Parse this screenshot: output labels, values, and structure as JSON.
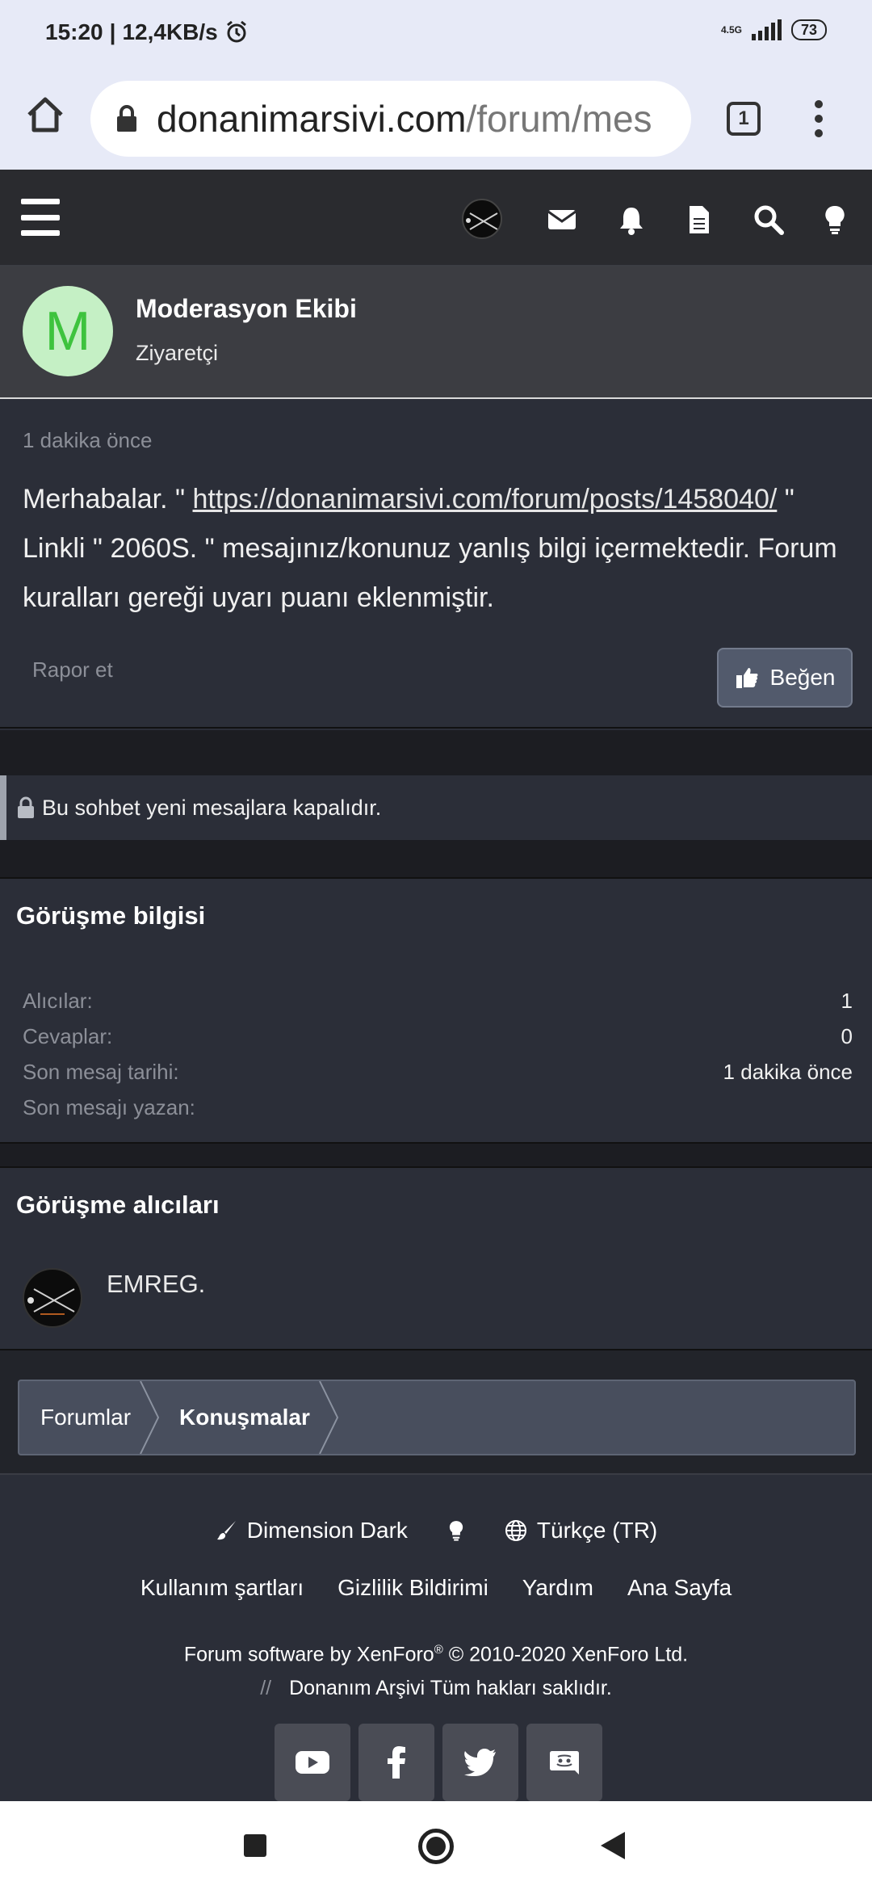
{
  "status_bar": {
    "time": "15:20",
    "speed": "12,4KB/s",
    "network": "4.5G",
    "battery": "73"
  },
  "browser": {
    "url_host": "donanimarsivi.com",
    "url_path": "/forum/mes",
    "tab_count": "1"
  },
  "message": {
    "author_initial": "M",
    "author_name": "Moderasyon Ekibi",
    "author_role": "Ziyaretçi",
    "time": "1 dakika önce",
    "text_before_link": "Merhabalar. \" ",
    "link": "https://donanimarsivi.com/forum/posts/1458040/",
    "text_after_link": " \" Linkli \" 2060S. \" mesajınız/konunuz yanlış bilgi içermektedir. Forum kuralları gereği uyarı puanı eklenmiştir.",
    "report_label": "Rapor et",
    "like_label": "Beğen"
  },
  "locked_notice": "Bu sohbet yeni mesajlara kapalıdır.",
  "info": {
    "title": "Görüşme bilgisi",
    "rows": [
      {
        "label": "Alıcılar:",
        "value": "1"
      },
      {
        "label": "Cevaplar:",
        "value": "0"
      },
      {
        "label": "Son mesaj tarihi:",
        "value": "1 dakika önce"
      },
      {
        "label": "Son mesajı yazan:",
        "value": ""
      }
    ]
  },
  "recipients": {
    "title": "Görüşme alıcıları",
    "items": [
      {
        "name": "EMREG."
      }
    ]
  },
  "breadcrumb": [
    "Forumlar",
    "Konuşmalar"
  ],
  "footer": {
    "style": "Dimension Dark",
    "language": "Türkçe (TR)",
    "links": [
      "Kullanım şartları",
      "Gizlilik Bildirimi",
      "Yardım",
      "Ana Sayfa"
    ],
    "copyright_prefix": "Forum software by XenForo",
    "copyright_reg": "®",
    "copyright_suffix": " © 2010-2020 XenForo Ltd.",
    "rights_separator": "//",
    "rights": "Donanım Arşivi Tüm hakları saklıdır.",
    "social": [
      "youtube-icon",
      "facebook-icon",
      "twitter-icon",
      "discord-icon"
    ]
  },
  "colors": {
    "page_bg": "#2b2e38",
    "header_bg": "#2a2b2f",
    "browser_bg": "#e7eaf7",
    "avatar_bg": "#c5f0c5",
    "avatar_fg": "#3ec33e",
    "button_bg": "#525a6c"
  }
}
